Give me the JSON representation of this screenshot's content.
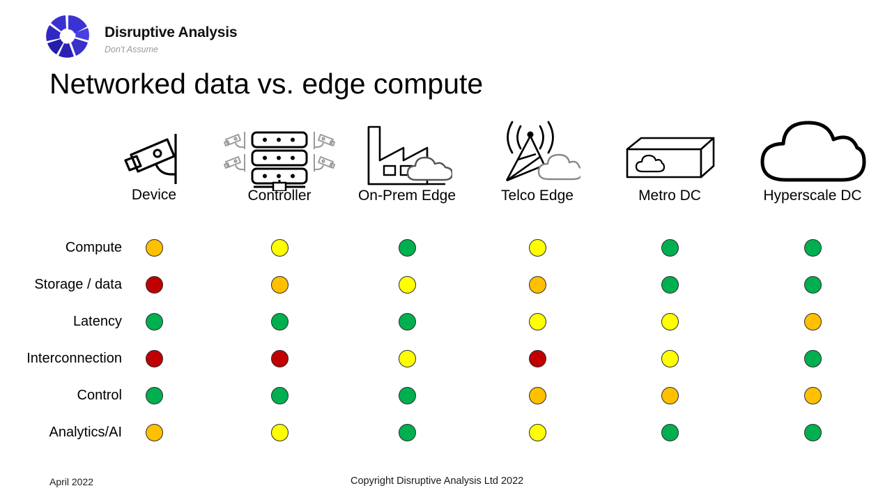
{
  "brand": {
    "name": "Disruptive Analysis",
    "tagline": "Don't Assume",
    "logo_icon": "segmented-donut-logo",
    "logo_colors": [
      "#2a22c8",
      "#3b2fd8",
      "#4a3fe0",
      "#2e25c2",
      "#1f17a8",
      "#3730d0"
    ],
    "tagline_color": "#9a9a9a"
  },
  "title": "Networked data vs. edge compute",
  "footer": {
    "date": "April 2022",
    "copyright": "Copyright Disruptive Analysis Ltd 2022"
  },
  "legend_colors": {
    "green": "#00B050",
    "yellow": "#FFFF00",
    "amber": "#FFC000",
    "red": "#C00000",
    "outline": "#2b2b2b"
  },
  "chart_data": {
    "type": "heatmap",
    "title": "Networked data vs. edge compute",
    "xlabel": "",
    "ylabel": "",
    "grid": false,
    "legend": "none",
    "value_scale": [
      "green",
      "yellow",
      "amber",
      "red"
    ],
    "categories": [
      {
        "label": "Device",
        "icon": "security-camera-icon"
      },
      {
        "label": "Controller",
        "icon": "server-rack-with-cameras-icon"
      },
      {
        "label": "On-Prem Edge",
        "icon": "factory-with-cloud-icon"
      },
      {
        "label": "Telco Edge",
        "icon": "cell-tower-with-cloud-icon"
      },
      {
        "label": "Metro DC",
        "icon": "server-box-with-cloud-icon"
      },
      {
        "label": "Hyperscale DC",
        "icon": "cloud-icon"
      }
    ],
    "rows": [
      {
        "label": "Compute",
        "values": [
          "amber",
          "yellow",
          "green",
          "yellow",
          "green",
          "green"
        ]
      },
      {
        "label": "Storage / data",
        "values": [
          "red",
          "amber",
          "yellow",
          "amber",
          "green",
          "green"
        ]
      },
      {
        "label": "Latency",
        "values": [
          "green",
          "green",
          "green",
          "yellow",
          "yellow",
          "amber"
        ]
      },
      {
        "label": "Interconnection",
        "values": [
          "red",
          "red",
          "yellow",
          "red",
          "yellow",
          "green"
        ]
      },
      {
        "label": "Control",
        "values": [
          "green",
          "green",
          "green",
          "amber",
          "amber",
          "amber"
        ]
      },
      {
        "label": "Analytics/AI",
        "values": [
          "amber",
          "yellow",
          "green",
          "yellow",
          "green",
          "green"
        ]
      }
    ]
  }
}
